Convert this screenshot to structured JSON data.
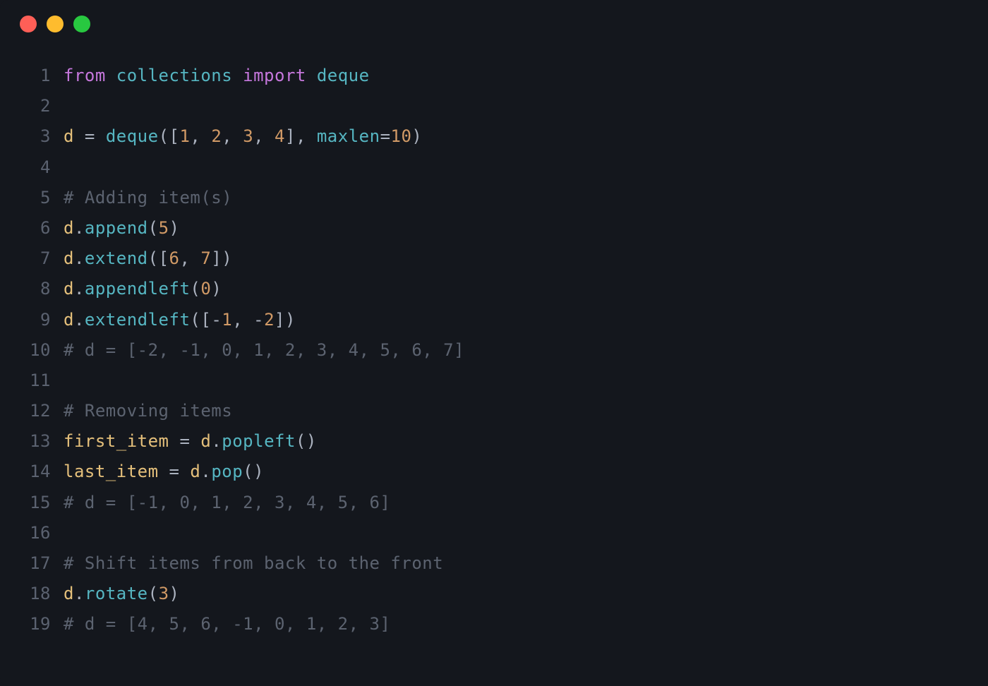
{
  "window": {
    "traffic_lights": [
      "close",
      "minimize",
      "zoom"
    ]
  },
  "colors": {
    "bg": "#14171d",
    "keyword": "#c678dd",
    "cyan": "#56b6c2",
    "variable": "#e5c07b",
    "number": "#d19a66",
    "comment": "#5c6370",
    "default": "#abb2bf",
    "linenum": "#5b6270"
  },
  "code": {
    "language": "python",
    "lines": [
      {
        "n": "1",
        "tokens": [
          {
            "t": "from",
            "c": "kw"
          },
          {
            "t": " "
          },
          {
            "t": "collections",
            "c": "mod"
          },
          {
            "t": " "
          },
          {
            "t": "import",
            "c": "kw"
          },
          {
            "t": " "
          },
          {
            "t": "deque",
            "c": "mod"
          }
        ]
      },
      {
        "n": "2",
        "tokens": []
      },
      {
        "n": "3",
        "tokens": [
          {
            "t": "d",
            "c": "var"
          },
          {
            "t": " "
          },
          {
            "t": "=",
            "c": "op"
          },
          {
            "t": " "
          },
          {
            "t": "deque",
            "c": "fn"
          },
          {
            "t": "(",
            "c": "punc"
          },
          {
            "t": "[",
            "c": "punc"
          },
          {
            "t": "1",
            "c": "num"
          },
          {
            "t": ",",
            "c": "op"
          },
          {
            "t": " "
          },
          {
            "t": "2",
            "c": "num"
          },
          {
            "t": ",",
            "c": "op"
          },
          {
            "t": " "
          },
          {
            "t": "3",
            "c": "num"
          },
          {
            "t": ",",
            "c": "op"
          },
          {
            "t": " "
          },
          {
            "t": "4",
            "c": "num"
          },
          {
            "t": "]",
            "c": "punc"
          },
          {
            "t": ",",
            "c": "op"
          },
          {
            "t": " "
          },
          {
            "t": "maxlen",
            "c": "mod"
          },
          {
            "t": "=",
            "c": "op"
          },
          {
            "t": "10",
            "c": "num"
          },
          {
            "t": ")",
            "c": "punc"
          }
        ]
      },
      {
        "n": "4",
        "tokens": []
      },
      {
        "n": "5",
        "tokens": [
          {
            "t": "# Adding item(s)",
            "c": "comment"
          }
        ]
      },
      {
        "n": "6",
        "tokens": [
          {
            "t": "d",
            "c": "var"
          },
          {
            "t": ".",
            "c": "op"
          },
          {
            "t": "append",
            "c": "fn"
          },
          {
            "t": "(",
            "c": "punc"
          },
          {
            "t": "5",
            "c": "num"
          },
          {
            "t": ")",
            "c": "punc"
          }
        ]
      },
      {
        "n": "7",
        "tokens": [
          {
            "t": "d",
            "c": "var"
          },
          {
            "t": ".",
            "c": "op"
          },
          {
            "t": "extend",
            "c": "fn"
          },
          {
            "t": "(",
            "c": "punc"
          },
          {
            "t": "[",
            "c": "punc"
          },
          {
            "t": "6",
            "c": "num"
          },
          {
            "t": ",",
            "c": "op"
          },
          {
            "t": " "
          },
          {
            "t": "7",
            "c": "num"
          },
          {
            "t": "]",
            "c": "punc"
          },
          {
            "t": ")",
            "c": "punc"
          }
        ]
      },
      {
        "n": "8",
        "tokens": [
          {
            "t": "d",
            "c": "var"
          },
          {
            "t": ".",
            "c": "op"
          },
          {
            "t": "appendleft",
            "c": "fn"
          },
          {
            "t": "(",
            "c": "punc"
          },
          {
            "t": "0",
            "c": "num"
          },
          {
            "t": ")",
            "c": "punc"
          }
        ]
      },
      {
        "n": "9",
        "tokens": [
          {
            "t": "d",
            "c": "var"
          },
          {
            "t": ".",
            "c": "op"
          },
          {
            "t": "extendleft",
            "c": "fn"
          },
          {
            "t": "(",
            "c": "punc"
          },
          {
            "t": "[",
            "c": "punc"
          },
          {
            "t": "-",
            "c": "op"
          },
          {
            "t": "1",
            "c": "num"
          },
          {
            "t": ",",
            "c": "op"
          },
          {
            "t": " "
          },
          {
            "t": "-",
            "c": "op"
          },
          {
            "t": "2",
            "c": "num"
          },
          {
            "t": "]",
            "c": "punc"
          },
          {
            "t": ")",
            "c": "punc"
          }
        ]
      },
      {
        "n": "10",
        "tokens": [
          {
            "t": "# d = [-2, -1, 0, 1, 2, 3, 4, 5, 6, 7]",
            "c": "comment"
          }
        ]
      },
      {
        "n": "11",
        "tokens": []
      },
      {
        "n": "12",
        "tokens": [
          {
            "t": "# Removing items",
            "c": "comment"
          }
        ]
      },
      {
        "n": "13",
        "tokens": [
          {
            "t": "first_item",
            "c": "var"
          },
          {
            "t": " "
          },
          {
            "t": "=",
            "c": "op"
          },
          {
            "t": " "
          },
          {
            "t": "d",
            "c": "var"
          },
          {
            "t": ".",
            "c": "op"
          },
          {
            "t": "popleft",
            "c": "fn"
          },
          {
            "t": "(",
            "c": "punc"
          },
          {
            "t": ")",
            "c": "punc"
          }
        ]
      },
      {
        "n": "14",
        "tokens": [
          {
            "t": "last_item",
            "c": "var"
          },
          {
            "t": " "
          },
          {
            "t": "=",
            "c": "op"
          },
          {
            "t": " "
          },
          {
            "t": "d",
            "c": "var"
          },
          {
            "t": ".",
            "c": "op"
          },
          {
            "t": "pop",
            "c": "fn"
          },
          {
            "t": "(",
            "c": "punc"
          },
          {
            "t": ")",
            "c": "punc"
          }
        ]
      },
      {
        "n": "15",
        "tokens": [
          {
            "t": "# d = [-1, 0, 1, 2, 3, 4, 5, 6]",
            "c": "comment"
          }
        ]
      },
      {
        "n": "16",
        "tokens": []
      },
      {
        "n": "17",
        "tokens": [
          {
            "t": "# Shift items from back to the front",
            "c": "comment"
          }
        ]
      },
      {
        "n": "18",
        "tokens": [
          {
            "t": "d",
            "c": "var"
          },
          {
            "t": ".",
            "c": "op"
          },
          {
            "t": "rotate",
            "c": "fn"
          },
          {
            "t": "(",
            "c": "punc"
          },
          {
            "t": "3",
            "c": "num"
          },
          {
            "t": ")",
            "c": "punc"
          }
        ]
      },
      {
        "n": "19",
        "tokens": [
          {
            "t": "# d = [4, 5, 6, -1, 0, 1, 2, 3]",
            "c": "comment"
          }
        ]
      }
    ]
  }
}
